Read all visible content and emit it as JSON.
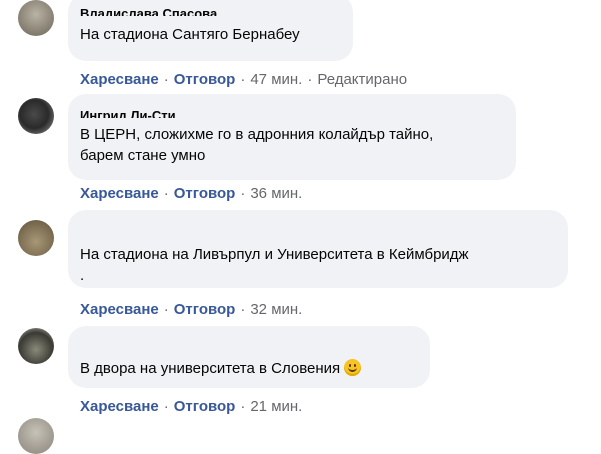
{
  "comments": [
    {
      "author": "Владислава Спасова",
      "text": "На стадиона Сантяго Бернабеу",
      "like": "Харесване",
      "reply": "Отговор",
      "time": "47 мин.",
      "edited": "Редактирано"
    },
    {
      "author": "Ингрид Ли-Сти",
      "text": "В ЦЕРН, сложихме го в адронния колайдър тайно,\nбарем стане умно",
      "like": "Харесване",
      "reply": "Отговор",
      "time": "36 мин."
    },
    {
      "author": "",
      "text": "На стадиона на Ливърпул и Университета в Кеймбридж\n.",
      "like": "Харесване",
      "reply": "Отговор",
      "time": "32 мин."
    },
    {
      "author": "",
      "text": "В двора на университета в Словения",
      "emoji": "smiley-face",
      "like": "Харесване",
      "reply": "Отговор",
      "time": "21 мин."
    }
  ],
  "separator": "·",
  "colors": {
    "bubble": "#f0f2f5",
    "action_link": "#385898",
    "meta": "#65676b"
  }
}
